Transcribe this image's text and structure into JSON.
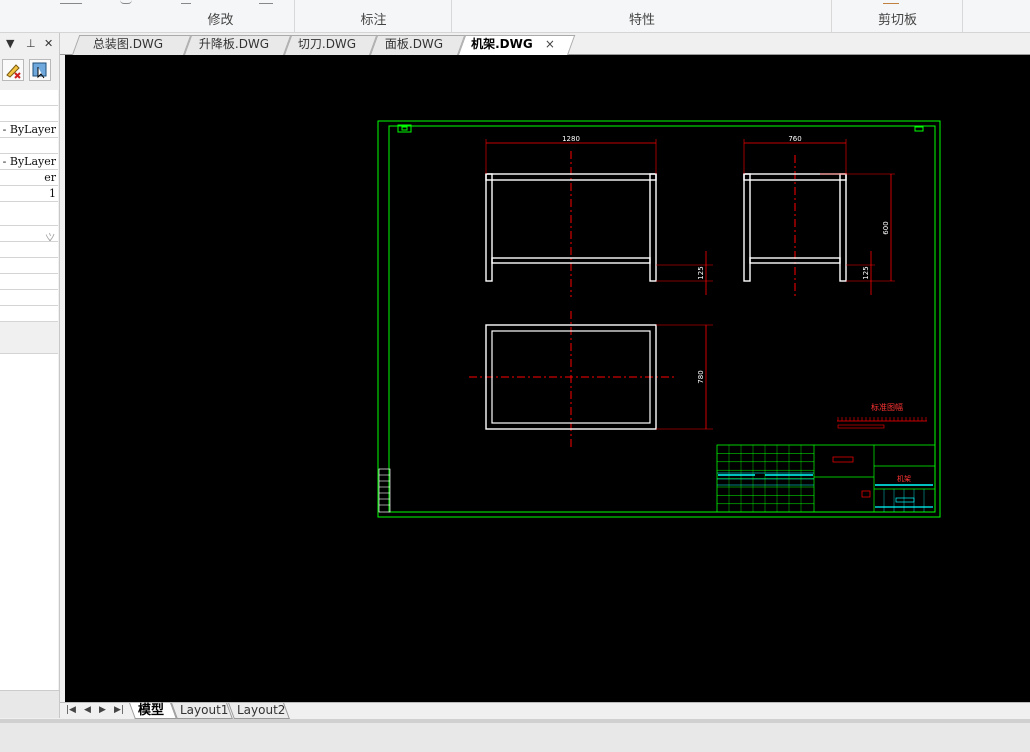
{
  "ribbon": {
    "groups": [
      {
        "label": "修改"
      },
      {
        "label": "标注"
      },
      {
        "label": "特性"
      },
      {
        "label": "剪切板"
      }
    ]
  },
  "left_panel": {
    "rows": [
      {
        "text": ""
      },
      {
        "text": ""
      },
      {
        "text": "- ByLayer"
      },
      {
        "text": ""
      },
      {
        "text": "- ByLayer"
      },
      {
        "text": "er"
      },
      {
        "text": "1"
      },
      {
        "text": ""
      },
      {
        "text": "义"
      },
      {
        "text": ""
      },
      {
        "text": ""
      },
      {
        "text": ""
      },
      {
        "text": ""
      },
      {
        "text": ""
      }
    ]
  },
  "tabs": [
    {
      "label": "总装图.DWG"
    },
    {
      "label": "升降板.DWG"
    },
    {
      "label": "切刀.DWG"
    },
    {
      "label": "面板.DWG"
    },
    {
      "label": "机架.DWG",
      "close": "×"
    }
  ],
  "drawing": {
    "dims": {
      "front_width": "1280",
      "side_width": "760",
      "side_height": "600",
      "front_foot": "125",
      "side_foot": "125",
      "top_depth": "780"
    },
    "scale_bar_label": "标准图幅",
    "title_block_name": "机架",
    "colors": {
      "border": "#00ff00",
      "object": "#ffffff",
      "dimension": "#ff0000",
      "title_text": "#00ffff"
    }
  },
  "layout_tabs": [
    {
      "label": "模型"
    },
    {
      "label": "Layout1"
    },
    {
      "label": "Layout2"
    }
  ]
}
